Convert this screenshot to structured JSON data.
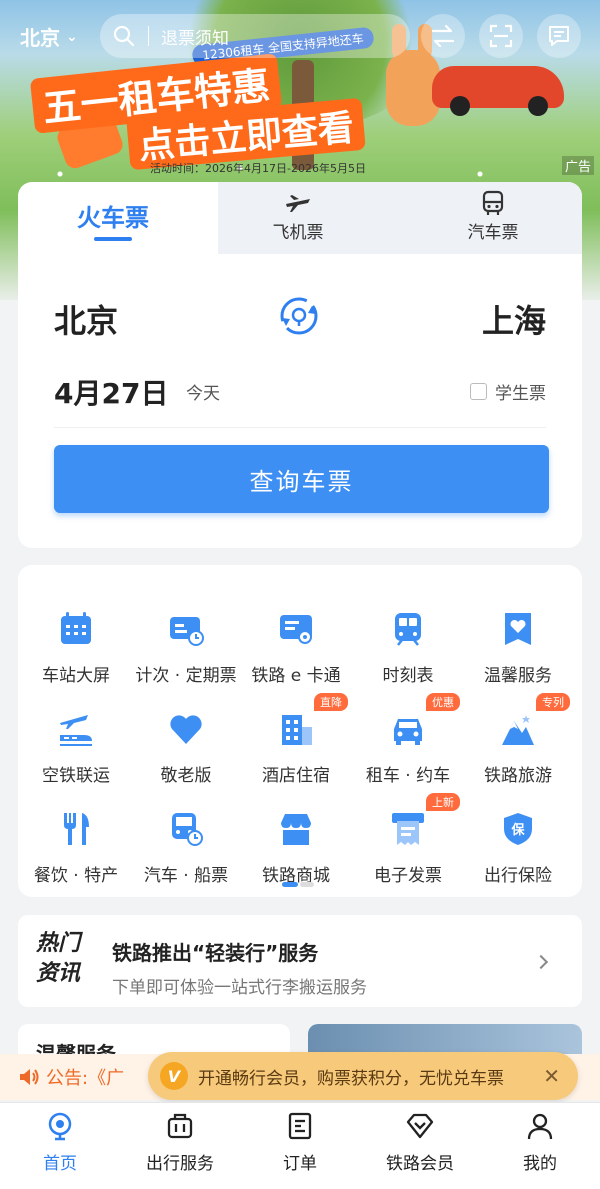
{
  "top_bar": {
    "city": "北京",
    "search_placeholder": "退票须知"
  },
  "banner": {
    "tag": "12306租车 全国支持异地还车",
    "headline_1": "五一租车特惠",
    "headline_2": "点击立即查看",
    "activity_time": "活动时间：2026年4月17日-2026年5月5日",
    "ad_label": "广告"
  },
  "ticket": {
    "tabs": [
      "火车票",
      "飞机票",
      "汽车票"
    ],
    "active_tab": "火车票",
    "from_city": "北京",
    "to_city": "上海",
    "date": "4月27日",
    "date_hint": "今天",
    "student_ticket_label": "学生票",
    "student_ticket_checked": false,
    "query_button": "查询车票"
  },
  "services": [
    {
      "label": "车站大屏",
      "icon": "station-screen-icon",
      "badge": ""
    },
    {
      "label": "计次 · 定期票",
      "icon": "ticket-card-icon",
      "badge": ""
    },
    {
      "label": "铁路 e 卡通",
      "icon": "e-card-icon",
      "badge": ""
    },
    {
      "label": "时刻表",
      "icon": "train-timetable-icon",
      "badge": ""
    },
    {
      "label": "温馨服务",
      "icon": "heart-tag-icon",
      "badge": ""
    },
    {
      "label": "空铁联运",
      "icon": "plane-train-icon",
      "badge": ""
    },
    {
      "label": "敬老版",
      "icon": "heart-icon",
      "badge": ""
    },
    {
      "label": "酒店住宿",
      "icon": "hotel-icon",
      "badge": "直降"
    },
    {
      "label": "租车 · 约车",
      "icon": "car-icon",
      "badge": "优惠"
    },
    {
      "label": "铁路旅游",
      "icon": "mountain-icon",
      "badge": "专列"
    },
    {
      "label": "餐饮 · 特产",
      "icon": "dining-icon",
      "badge": ""
    },
    {
      "label": "汽车 · 船票",
      "icon": "bus-icon",
      "badge": ""
    },
    {
      "label": "铁路商城",
      "icon": "shop-icon",
      "badge": ""
    },
    {
      "label": "电子发票",
      "icon": "invoice-icon",
      "badge": "上新"
    },
    {
      "label": "出行保险",
      "icon": "insurance-shield-icon",
      "badge": ""
    }
  ],
  "news": {
    "tag": "热门资讯",
    "title": "铁路推出“轻装行”服务",
    "subtitle": "下单即可体验一站式行李搬运服务"
  },
  "cards": {
    "left_title": "温馨服务"
  },
  "notice": {
    "text": "公告:《广"
  },
  "member_pill": {
    "badge": "V",
    "text": "开通畅行会员，购票获积分，无忧兑车票"
  },
  "bottom_nav": [
    {
      "label": "首页",
      "active": true
    },
    {
      "label": "出行服务",
      "active": false
    },
    {
      "label": "订单",
      "active": false
    },
    {
      "label": "铁路会员",
      "active": false
    },
    {
      "label": "我的",
      "active": false
    }
  ],
  "colors": {
    "accent": "#2e7fef",
    "button": "#3d8ff3",
    "badge": "#ff6b3d",
    "notice_text": "#ee6a28"
  }
}
